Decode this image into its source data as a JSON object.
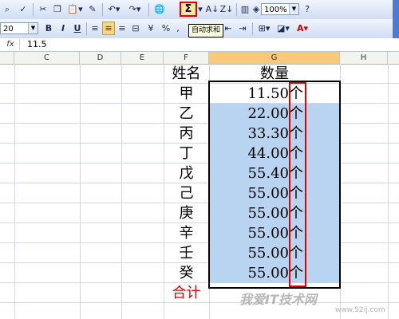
{
  "toolbar1": {
    "autosum_symbol": "Σ",
    "zoom": "100%"
  },
  "toolbar2": {
    "font_size": "20",
    "bold": "B",
    "italic": "I",
    "underline": "U",
    "percent": "%",
    "comma": ","
  },
  "tooltip": "自动求和",
  "formula_bar": {
    "fx_label": "fx",
    "value": "11.5"
  },
  "columns": [
    "C",
    "D",
    "E",
    "F",
    "G",
    "H"
  ],
  "table": {
    "header_name": "姓名",
    "header_qty": "数量",
    "rows": [
      {
        "name": "甲",
        "qty": "11.50",
        "unit": "个"
      },
      {
        "name": "乙",
        "qty": "22.00",
        "unit": "个"
      },
      {
        "name": "丙",
        "qty": "33.30",
        "unit": "个"
      },
      {
        "name": "丁",
        "qty": "44.00",
        "unit": "个"
      },
      {
        "name": "戊",
        "qty": "55.40",
        "unit": "个"
      },
      {
        "name": "己",
        "qty": "55.00",
        "unit": "个"
      },
      {
        "name": "庚",
        "qty": "55.00",
        "unit": "个"
      },
      {
        "name": "辛",
        "qty": "55.00",
        "unit": "个"
      },
      {
        "name": "壬",
        "qty": "55.00",
        "unit": "个"
      },
      {
        "name": "癸",
        "qty": "55.00",
        "unit": "个"
      }
    ],
    "total_label": "合计"
  },
  "watermark": {
    "text": "我爱IT技术网",
    "url": "www.52ij.com"
  },
  "colors": {
    "selection": "#b9d4f0",
    "highlight_red": "#e10000"
  }
}
